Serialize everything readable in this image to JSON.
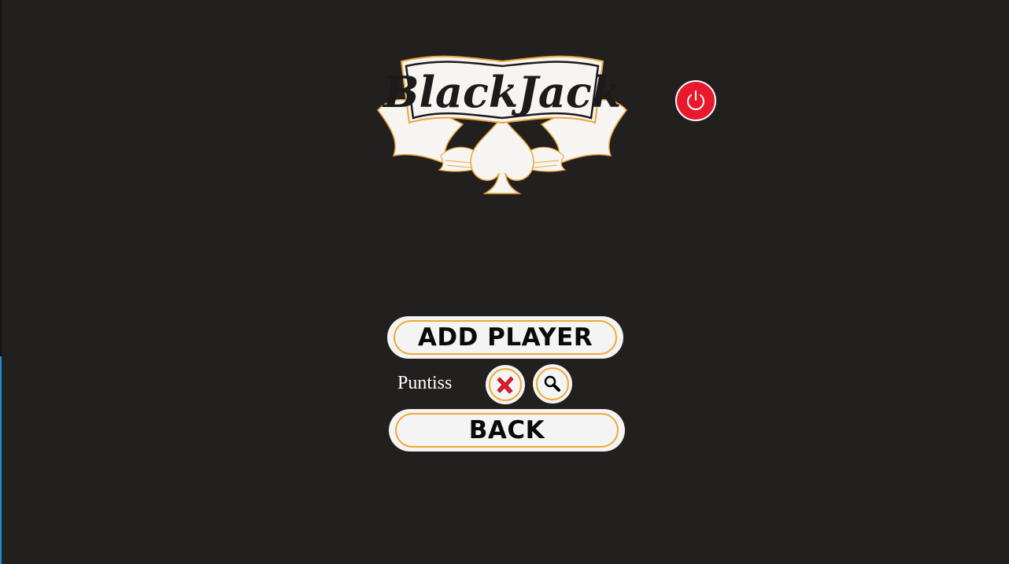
{
  "logo": {
    "text": "BlackJack",
    "icon": "blackjack-spade-banner-logo"
  },
  "header": {
    "power_icon": "power-icon"
  },
  "menu": {
    "add_player_label": "ADD PLAYER",
    "back_label": "BACK"
  },
  "players": [
    {
      "name": "Puntiss",
      "remove_icon": "x-mark-icon",
      "view_icon": "magnifier-icon"
    }
  ],
  "colors": {
    "background": "#221f1f",
    "button_fill": "#f4f4f4",
    "button_border": "#f0a836",
    "power_red": "#e8192c",
    "accent_blue": "#1e8fd6"
  }
}
